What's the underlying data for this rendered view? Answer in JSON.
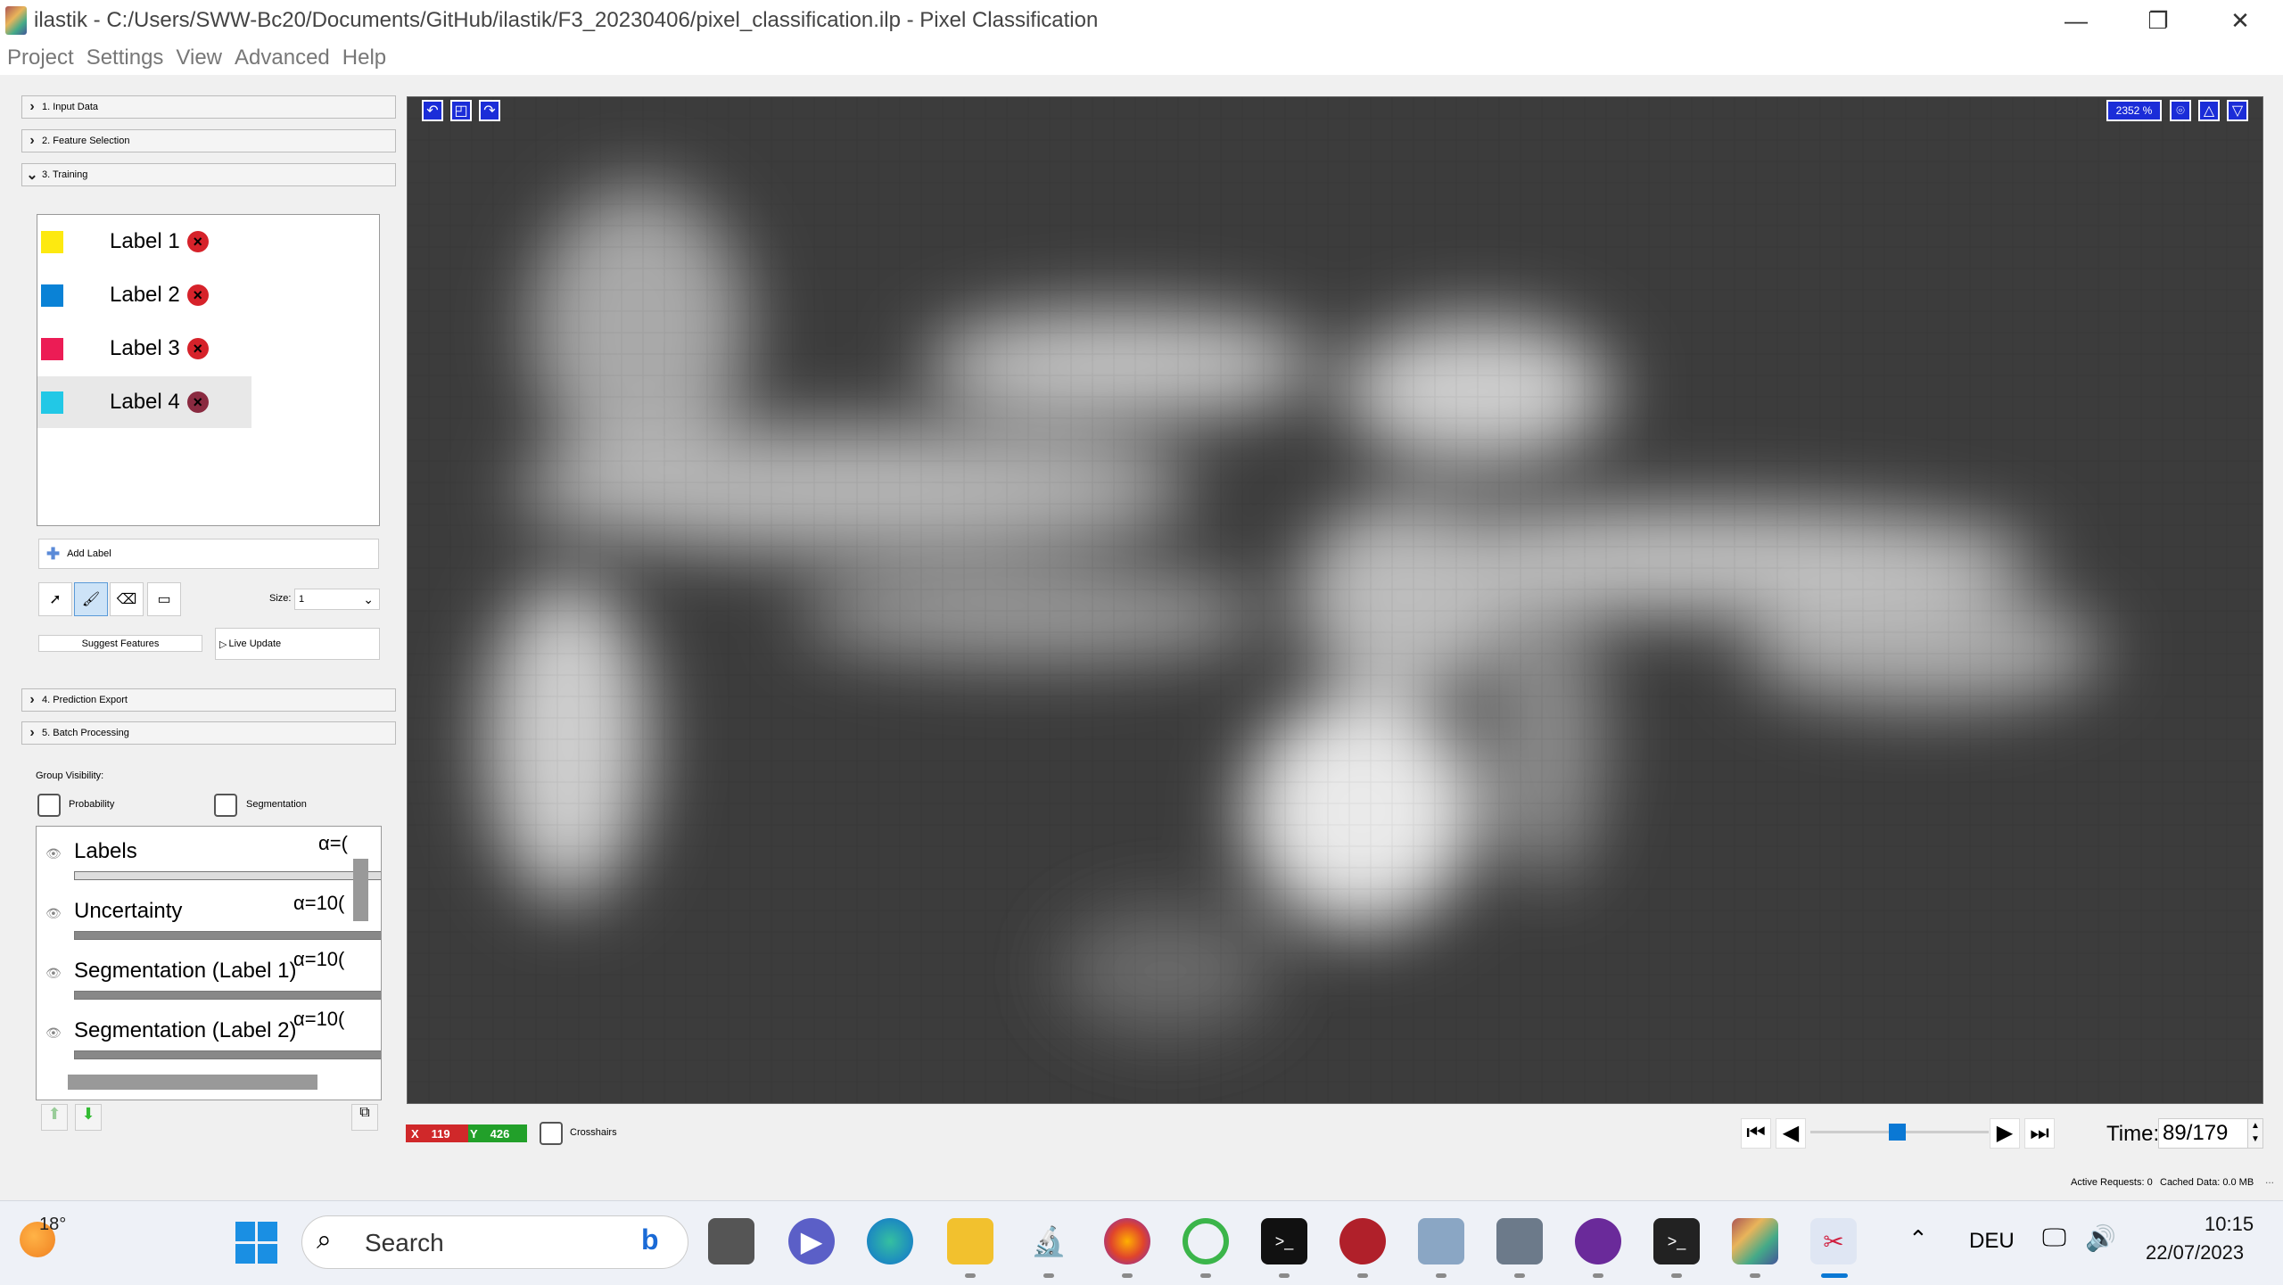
{
  "window": {
    "title": "ilastik - C:/Users/SWW-Bc20/Documents/GitHub/ilastik/F3_20230406/pixel_classification.ilp - Pixel Classification",
    "minimize": "—",
    "restore": "❐",
    "close": "✕"
  },
  "menu": [
    "Project",
    "Settings",
    "View",
    "Advanced",
    "Help"
  ],
  "applets": {
    "input_data": "1. Input Data",
    "feature_selection": "2. Feature Selection",
    "training": "3. Training",
    "prediction_export": "4. Prediction Export",
    "batch_processing": "5. Batch Processing"
  },
  "labels": [
    {
      "name": "Label 1",
      "color": "#fde910"
    },
    {
      "name": "Label 2",
      "color": "#0a82d6"
    },
    {
      "name": "Label 3",
      "color": "#ec1c55"
    },
    {
      "name": "Label 4",
      "color": "#22c8e6"
    }
  ],
  "training": {
    "add_label": "Add Label",
    "size_label": "Size:",
    "size_value": "1",
    "suggest_features": "Suggest Features",
    "live_update": "Live Update",
    "group_visibility": "Group Visibility:",
    "probability": "Probability",
    "segmentation": "Segmentation"
  },
  "layers": [
    {
      "name": "Labels",
      "alpha": "α=("
    },
    {
      "name": "Uncertainty",
      "alpha": "α=10("
    },
    {
      "name": "Segmentation (Label 1)",
      "alpha": "α=10("
    },
    {
      "name": "Segmentation (Label 2)",
      "alpha": "α=10("
    }
  ],
  "viewer": {
    "zoom": "2352 %",
    "x_label": "X",
    "x_value": "119",
    "y_label": "Y",
    "y_value": "426",
    "crosshairs": "Crosshairs",
    "time_label": "Time:",
    "time_value": "89/179"
  },
  "status": {
    "active_requests": "Active Requests: 0",
    "cached_data": "Cached Data: 0.0 MB"
  },
  "taskbar": {
    "weather_temp": "18°",
    "search": "Search",
    "language": "DEU",
    "time": "10:15",
    "date": "22/07/2023"
  }
}
